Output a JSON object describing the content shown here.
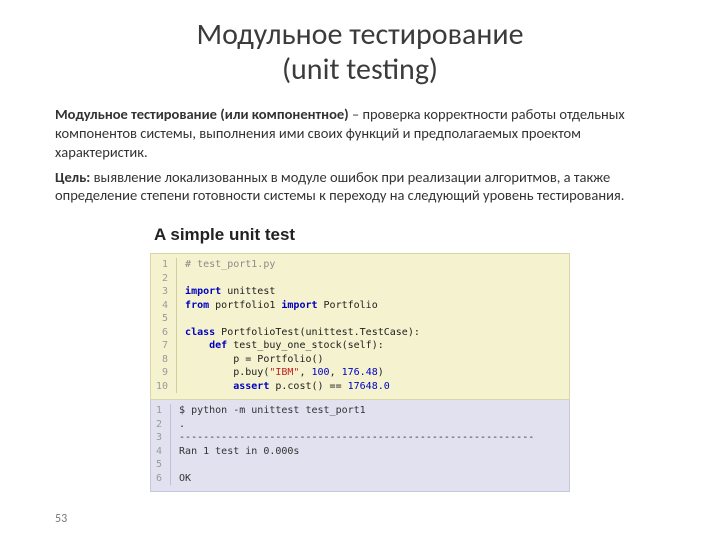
{
  "title_line1": "Модульное тестирование",
  "title_line2": "(unit testing)",
  "para1_bold": "Модульное тестирование (или компонентное)",
  "para1_rest": " – проверка корректности работы отдельных компонентов системы, выполнения ими своих функций и предполагаемых проектом характеристик.",
  "para2_bold": "Цель:",
  "para2_rest": " выявление локализованных в модуле ошибок при реализации алгоритмов, а также определение степени готовности системы к переходу на следующий уровень тестирования.",
  "figure": {
    "heading": "A simple unit test",
    "code_gutter": "1\n2\n3\n4\n5\n6\n7\n8\n9\n10",
    "code": {
      "l1": "# test_port1.py",
      "l3a": "import",
      "l3b": " unittest",
      "l4a": "from",
      "l4b": " portfolio1 ",
      "l4c": "import",
      "l4d": " Portfolio",
      "l6a": "class",
      "l6b": " PortfolioTest(unittest.TestCase):",
      "l7a": "def",
      "l7b": " test_buy_one_stock(self):",
      "l8": "p = Portfolio()",
      "l9a": "p.buy(",
      "l9b": "\"IBM\"",
      "l9c": ", ",
      "l9d": "100",
      "l9e": ", ",
      "l9f": "176.48",
      "l9g": ")",
      "l10a": "assert",
      "l10b": " p.cost() == ",
      "l10c": "17648.0"
    },
    "out_gutter": "1\n2\n3\n4\n5\n6",
    "out": {
      "l1": "$ python -m unittest test_port1",
      "l2": ".",
      "l3": "-----------------------------------------------------------",
      "l4": "Ran 1 test in 0.000s",
      "l6": "OK"
    }
  },
  "page_number": "53"
}
